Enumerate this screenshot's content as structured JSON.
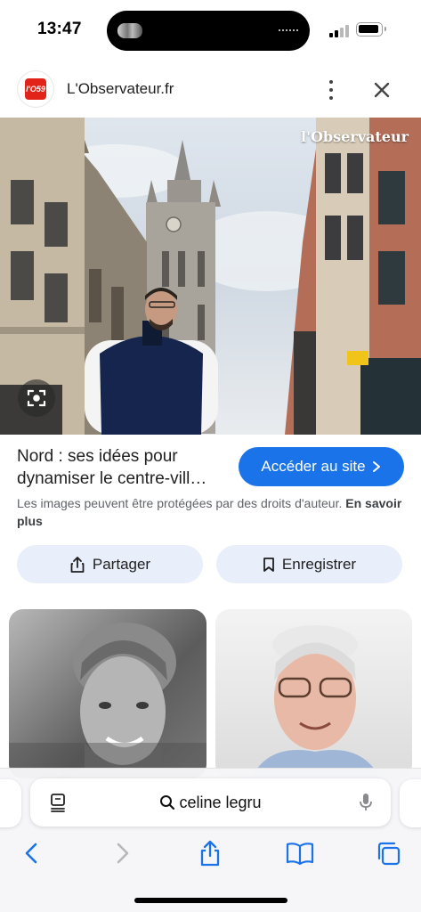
{
  "status_bar": {
    "time": "13:47"
  },
  "site": {
    "name": "L'Observateur.fr",
    "logo_text": "l'O59"
  },
  "hero": {
    "watermark": "l'Observateur"
  },
  "result": {
    "title": "Nord : ses idées pour dynamiser le centre-vill…",
    "visit_label": "Accéder au site",
    "copyright_text": "Les images peuvent être protégées par des droits d'auteur.",
    "learn_more": "En savoir plus"
  },
  "actions": {
    "share_label": "Partager",
    "save_label": "Enregistrer"
  },
  "toolbar": {
    "address": "celine legru"
  },
  "colors": {
    "accent": "#1a73e8",
    "chip_bg": "#e8eefa",
    "link": "#1a73e8"
  },
  "icons": [
    "search-icon",
    "microphone-icon",
    "reader-icon",
    "share-icon",
    "bookmark-icon",
    "back-icon",
    "forward-icon",
    "book-icon",
    "tabs-icon",
    "close-icon",
    "more-icon",
    "lens-icon"
  ]
}
